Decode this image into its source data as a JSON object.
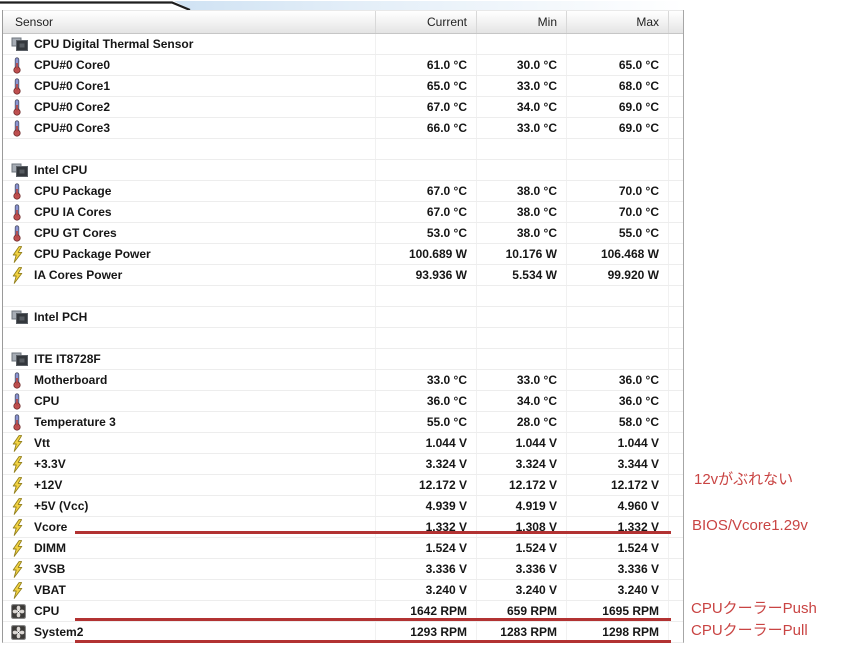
{
  "table": {
    "columns": [
      "Sensor",
      "Current",
      "Min",
      "Max"
    ],
    "rows": [
      {
        "type": "section",
        "icon": "chip",
        "label": "CPU Digital Thermal Sensor",
        "current": "",
        "min": "",
        "max": ""
      },
      {
        "type": "temp",
        "icon": "thermometer",
        "label": "CPU#0 Core0",
        "current": "61.0 °C",
        "min": "30.0 °C",
        "max": "65.0 °C"
      },
      {
        "type": "temp",
        "icon": "thermometer",
        "label": "CPU#0 Core1",
        "current": "65.0 °C",
        "min": "33.0 °C",
        "max": "68.0 °C"
      },
      {
        "type": "temp",
        "icon": "thermometer",
        "label": "CPU#0 Core2",
        "current": "67.0 °C",
        "min": "34.0 °C",
        "max": "69.0 °C"
      },
      {
        "type": "temp",
        "icon": "thermometer",
        "label": "CPU#0 Core3",
        "current": "66.0 °C",
        "min": "33.0 °C",
        "max": "69.0 °C"
      },
      {
        "type": "blank",
        "icon": "",
        "label": "",
        "current": "",
        "min": "",
        "max": ""
      },
      {
        "type": "section",
        "icon": "chip",
        "label": "Intel CPU",
        "current": "",
        "min": "",
        "max": ""
      },
      {
        "type": "temp",
        "icon": "thermometer",
        "label": "CPU Package",
        "current": "67.0 °C",
        "min": "38.0 °C",
        "max": "70.0 °C"
      },
      {
        "type": "temp",
        "icon": "thermometer",
        "label": "CPU IA Cores",
        "current": "67.0 °C",
        "min": "38.0 °C",
        "max": "70.0 °C"
      },
      {
        "type": "temp",
        "icon": "thermometer",
        "label": "CPU GT Cores",
        "current": "53.0 °C",
        "min": "38.0 °C",
        "max": "55.0 °C"
      },
      {
        "type": "power",
        "icon": "lightning",
        "label": "CPU Package Power",
        "current": "100.689 W",
        "min": "10.176 W",
        "max": "106.468 W"
      },
      {
        "type": "power",
        "icon": "lightning",
        "label": "IA Cores Power",
        "current": "93.936 W",
        "min": "5.534 W",
        "max": "99.920 W"
      },
      {
        "type": "blank",
        "icon": "",
        "label": "",
        "current": "",
        "min": "",
        "max": ""
      },
      {
        "type": "section",
        "icon": "chip",
        "label": "Intel PCH",
        "current": "",
        "min": "",
        "max": ""
      },
      {
        "type": "blank",
        "icon": "",
        "label": "",
        "current": "",
        "min": "",
        "max": ""
      },
      {
        "type": "section",
        "icon": "chip",
        "label": "ITE IT8728F",
        "current": "",
        "min": "",
        "max": ""
      },
      {
        "type": "temp",
        "icon": "thermometer",
        "label": "Motherboard",
        "current": "33.0 °C",
        "min": "33.0 °C",
        "max": "36.0 °C"
      },
      {
        "type": "temp",
        "icon": "thermometer",
        "label": "CPU",
        "current": "36.0 °C",
        "min": "34.0 °C",
        "max": "36.0 °C"
      },
      {
        "type": "temp",
        "icon": "thermometer",
        "label": "Temperature 3",
        "current": "55.0 °C",
        "min": "28.0 °C",
        "max": "58.0 °C"
      },
      {
        "type": "volt",
        "icon": "lightning",
        "label": "Vtt",
        "current": "1.044 V",
        "min": "1.044 V",
        "max": "1.044 V"
      },
      {
        "type": "volt",
        "icon": "lightning",
        "label": "+3.3V",
        "current": "3.324 V",
        "min": "3.324 V",
        "max": "3.344 V"
      },
      {
        "type": "volt",
        "icon": "lightning",
        "label": "+12V",
        "current": "12.172 V",
        "min": "12.172 V",
        "max": "12.172 V"
      },
      {
        "type": "volt",
        "icon": "lightning",
        "label": "+5V (Vcc)",
        "current": "4.939 V",
        "min": "4.919 V",
        "max": "4.960 V"
      },
      {
        "type": "volt",
        "icon": "lightning",
        "label": "Vcore",
        "current": "1.332 V",
        "min": "1.308 V",
        "max": "1.332 V"
      },
      {
        "type": "volt",
        "icon": "lightning",
        "label": "DIMM",
        "current": "1.524 V",
        "min": "1.524 V",
        "max": "1.524 V"
      },
      {
        "type": "volt",
        "icon": "lightning",
        "label": "3VSB",
        "current": "3.336 V",
        "min": "3.336 V",
        "max": "3.336 V"
      },
      {
        "type": "volt",
        "icon": "lightning",
        "label": "VBAT",
        "current": "3.240 V",
        "min": "3.240 V",
        "max": "3.240 V"
      },
      {
        "type": "fan",
        "icon": "fan",
        "label": "CPU",
        "current": "1642 RPM",
        "min": "659 RPM",
        "max": "1695 RPM"
      },
      {
        "type": "fan",
        "icon": "fan",
        "label": "System2",
        "current": "1293 RPM",
        "min": "1283 RPM",
        "max": "1298 RPM"
      }
    ]
  },
  "annotations": {
    "note_12v": "12vがぶれない",
    "note_vcore_bios": "BIOS/Vcore1.29v",
    "note_cooler_push": "CPUクーラーPush",
    "note_cooler_pull": "CPUクーラーPull"
  },
  "colors": {
    "annotation_text": "#c94443",
    "annotation_line": "#b23232",
    "tab_strip": "#d5e5f4"
  }
}
